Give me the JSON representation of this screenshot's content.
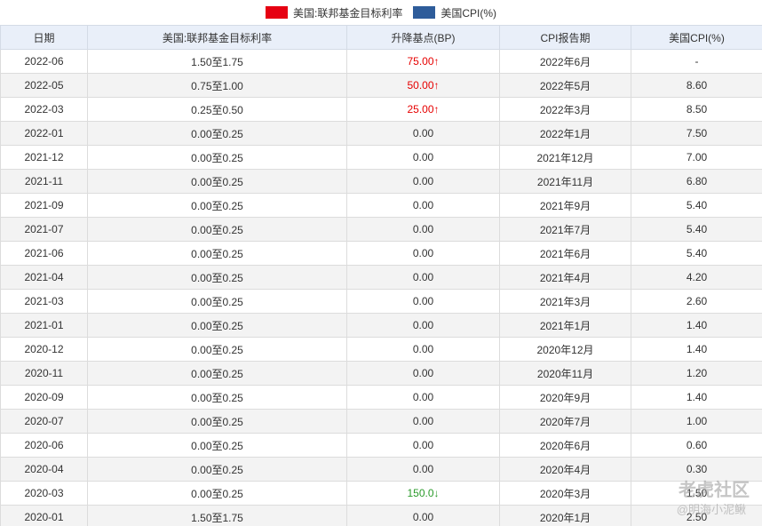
{
  "chart_data": {
    "type": "table",
    "legend": [
      {
        "label": "美国:联邦基金目标利率",
        "color": "#e60012"
      },
      {
        "label": "美国CPI(%)",
        "color": "#2e5c9a"
      }
    ],
    "headers": [
      "日期",
      "美国:联邦基金目标利率",
      "升降基点(BP)",
      "CPI报告期",
      "美国CPI(%)"
    ],
    "rows": [
      {
        "date": "2022-06",
        "rate": "1.50至1.75",
        "bp": "75.00↑",
        "dir": "up",
        "period": "2022年6月",
        "cpi": "-"
      },
      {
        "date": "2022-05",
        "rate": "0.75至1.00",
        "bp": "50.00↑",
        "dir": "up",
        "period": "2022年5月",
        "cpi": "8.60"
      },
      {
        "date": "2022-03",
        "rate": "0.25至0.50",
        "bp": "25.00↑",
        "dir": "up",
        "period": "2022年3月",
        "cpi": "8.50"
      },
      {
        "date": "2022-01",
        "rate": "0.00至0.25",
        "bp": "0.00",
        "dir": "",
        "period": "2022年1月",
        "cpi": "7.50"
      },
      {
        "date": "2021-12",
        "rate": "0.00至0.25",
        "bp": "0.00",
        "dir": "",
        "period": "2021年12月",
        "cpi": "7.00"
      },
      {
        "date": "2021-11",
        "rate": "0.00至0.25",
        "bp": "0.00",
        "dir": "",
        "period": "2021年11月",
        "cpi": "6.80"
      },
      {
        "date": "2021-09",
        "rate": "0.00至0.25",
        "bp": "0.00",
        "dir": "",
        "period": "2021年9月",
        "cpi": "5.40"
      },
      {
        "date": "2021-07",
        "rate": "0.00至0.25",
        "bp": "0.00",
        "dir": "",
        "period": "2021年7月",
        "cpi": "5.40"
      },
      {
        "date": "2021-06",
        "rate": "0.00至0.25",
        "bp": "0.00",
        "dir": "",
        "period": "2021年6月",
        "cpi": "5.40"
      },
      {
        "date": "2021-04",
        "rate": "0.00至0.25",
        "bp": "0.00",
        "dir": "",
        "period": "2021年4月",
        "cpi": "4.20"
      },
      {
        "date": "2021-03",
        "rate": "0.00至0.25",
        "bp": "0.00",
        "dir": "",
        "period": "2021年3月",
        "cpi": "2.60"
      },
      {
        "date": "2021-01",
        "rate": "0.00至0.25",
        "bp": "0.00",
        "dir": "",
        "period": "2021年1月",
        "cpi": "1.40"
      },
      {
        "date": "2020-12",
        "rate": "0.00至0.25",
        "bp": "0.00",
        "dir": "",
        "period": "2020年12月",
        "cpi": "1.40"
      },
      {
        "date": "2020-11",
        "rate": "0.00至0.25",
        "bp": "0.00",
        "dir": "",
        "period": "2020年11月",
        "cpi": "1.20"
      },
      {
        "date": "2020-09",
        "rate": "0.00至0.25",
        "bp": "0.00",
        "dir": "",
        "period": "2020年9月",
        "cpi": "1.40"
      },
      {
        "date": "2020-07",
        "rate": "0.00至0.25",
        "bp": "0.00",
        "dir": "",
        "period": "2020年7月",
        "cpi": "1.00"
      },
      {
        "date": "2020-06",
        "rate": "0.00至0.25",
        "bp": "0.00",
        "dir": "",
        "period": "2020年6月",
        "cpi": "0.60"
      },
      {
        "date": "2020-04",
        "rate": "0.00至0.25",
        "bp": "0.00",
        "dir": "",
        "period": "2020年4月",
        "cpi": "0.30"
      },
      {
        "date": "2020-03",
        "rate": "0.00至0.25",
        "bp": "150.0↓",
        "dir": "down",
        "period": "2020年3月",
        "cpi": "1.50"
      },
      {
        "date": "2020-01",
        "rate": "1.50至1.75",
        "bp": "0.00",
        "dir": "",
        "period": "2020年1月",
        "cpi": "2.50"
      }
    ]
  },
  "watermark": {
    "main": "老虎社区",
    "sub": "@明海小泥鳅"
  }
}
